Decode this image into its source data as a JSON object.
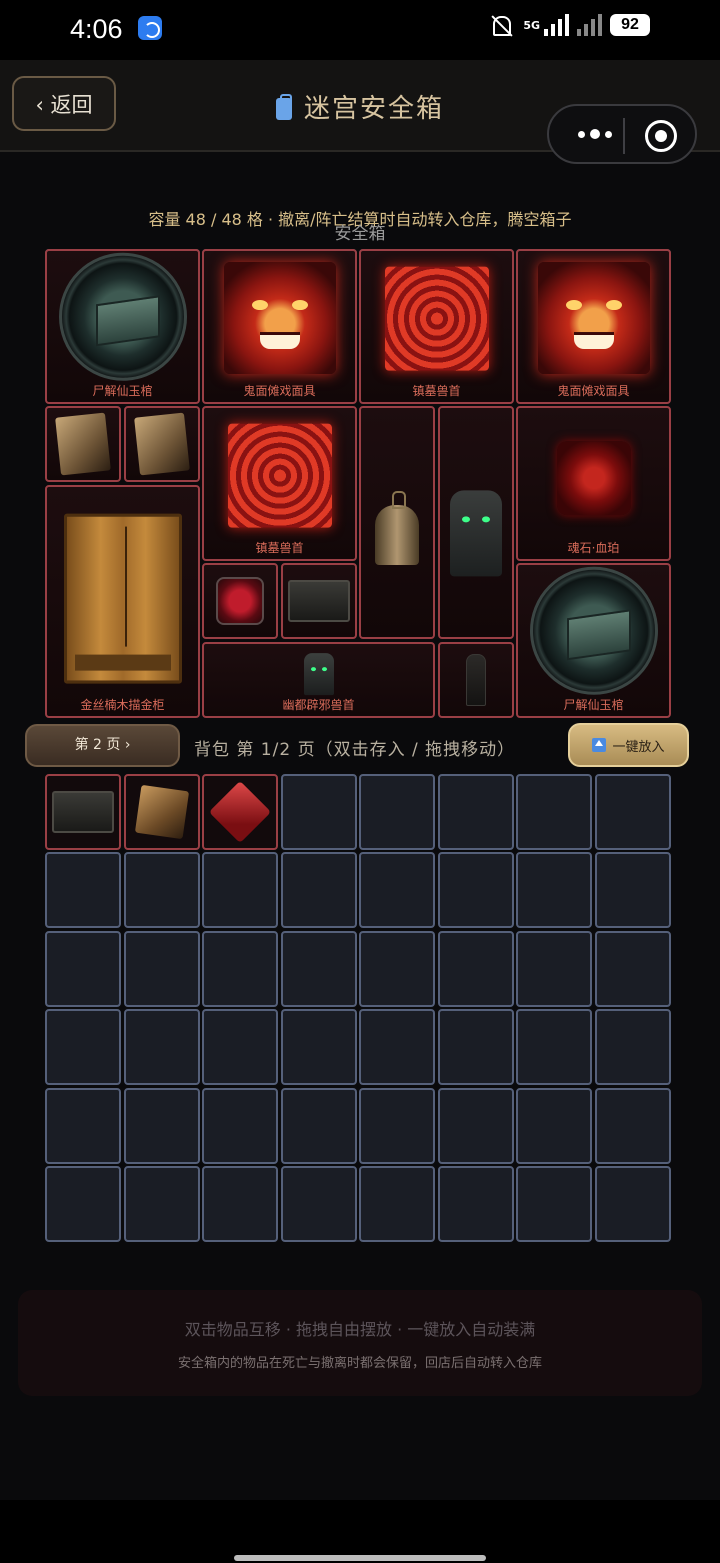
{
  "status_bar": {
    "time": "4:06",
    "network": "5G",
    "battery": "92"
  },
  "header": {
    "back_label": "‹ 返回",
    "title": "迷宫安全箱"
  },
  "capacity_text": "容量 48 / 48 格 · 撤离/阵亡结算时自动转入仓库，腾空箱子",
  "box_label": "安全箱",
  "safe_items": [
    {
      "name": "尸解仙玉棺",
      "icon": "jade-coffin-icon"
    },
    {
      "name": "鬼面傩戏面具",
      "icon": "demon-mask-icon"
    },
    {
      "name": "镇墓兽首",
      "icon": "tomb-beast-head-icon"
    },
    {
      "name": "鬼面傩戏面具",
      "icon": "demon-mask-icon"
    },
    {
      "name": "",
      "icon": "scroll-icon"
    },
    {
      "name": "",
      "icon": "scroll-icon"
    },
    {
      "name": "镇墓兽首",
      "icon": "tomb-beast-head-icon"
    },
    {
      "name": "",
      "icon": "bronze-bell-icon"
    },
    {
      "name": "",
      "icon": "stone-idol-icon"
    },
    {
      "name": "魂石·血珀",
      "icon": "blood-amber-icon"
    },
    {
      "name": "金丝楠木描金柜",
      "icon": "wooden-cabinet-icon"
    },
    {
      "name": "",
      "icon": "heart-icon"
    },
    {
      "name": "",
      "icon": "stone-tablet-icon"
    },
    {
      "name": "尸解仙玉棺",
      "icon": "jade-coffin-icon"
    },
    {
      "name": "幽都辟邪兽首",
      "icon": "mini-idol-icon"
    },
    {
      "name": "",
      "icon": "stele-icon"
    }
  ],
  "controls": {
    "page_button": "第 2 页 ›",
    "bag_title": "背包 第 1/2 页（双击存入 / 拖拽移动）",
    "fill_button": "一键放入"
  },
  "bag_items": [
    {
      "icon": "stone-tablet-icon"
    },
    {
      "icon": "ore-cube-icon"
    },
    {
      "icon": "red-gem-icon"
    }
  ],
  "hint": {
    "line1": "双击物品互移 · 拖拽自由摆放 · 一键放入自动装满",
    "line2": "安全箱内的物品在死亡与撤离时都会保留，回店后自动转入仓库"
  },
  "colors": {
    "accent_gold": "#d7bb82",
    "item_border": "#9a3f45",
    "item_label": "#d96c5a",
    "empty_slot_border": "#55607a"
  }
}
